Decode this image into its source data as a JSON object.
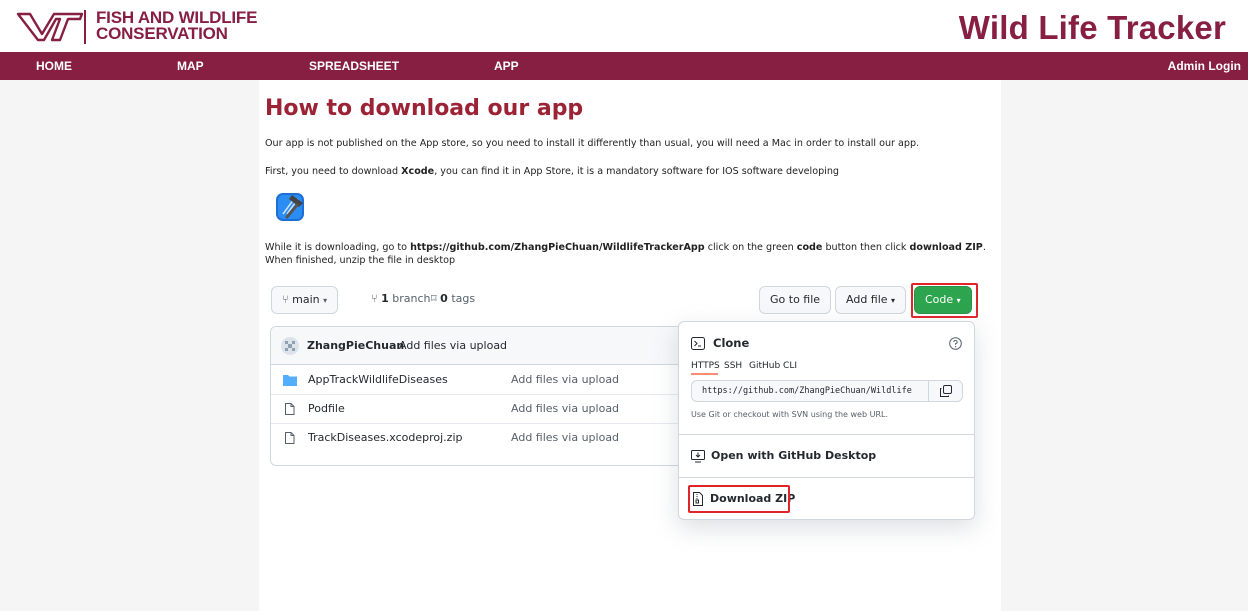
{
  "header": {
    "org_line1": "FISH AND WILDLIFE",
    "org_line2": "CONSERVATION",
    "site_title": "Wild Life Tracker",
    "logo_icon": "vt-logo-icon"
  },
  "nav": {
    "home": "HOME",
    "map": "MAP",
    "spreadsheet": "SPREADSHEET",
    "app": "APP",
    "admin": "Admin Login"
  },
  "main": {
    "title": "How to download our app",
    "intro": "Our app is not published on the App store, so you need to install it differently than usual, you will need a Mac in order to install our app.",
    "xcode_pre": "First, you need to download ",
    "xcode_bold": "Xcode",
    "xcode_post": ", you can find it in App Store, it is a mandatory software for IOS software developing",
    "dl_pre": "While it is downloading, go to ",
    "dl_url": "https://github.com/ZhangPieChuan/WildlifeTrackerApp",
    "dl_mid1": " click on the green ",
    "dl_code": "code",
    "dl_mid2": " button then click ",
    "dl_zip": "download ZIP",
    "dl_post": ". When finished, unzip the file in desktop"
  },
  "github": {
    "branch_label": "main",
    "branch_count": "1",
    "branch_word": "branch",
    "tag_count": "0",
    "tag_word": "tags",
    "goto_file": "Go to file",
    "add_file": "Add file",
    "code_button": "Code",
    "commit_author": "ZhangPieChuan",
    "commit_message": "Add files via upload",
    "files": [
      {
        "name": "AppTrackWildlifeDiseases",
        "message": "Add files via upload",
        "icon": "folder-icon"
      },
      {
        "name": "Podfile",
        "message": "Add files via upload",
        "icon": "file-icon"
      },
      {
        "name": "TrackDiseases.xcodeproj.zip",
        "message": "Add files via upload",
        "icon": "file-icon"
      }
    ],
    "clone": {
      "title": "Clone",
      "tab_https": "HTTPS",
      "tab_ssh": "SSH",
      "tab_cli": "GitHub CLI",
      "url": "https://github.com/ZhangPieChuan/Wildlife",
      "hint": "Use Git or checkout with SVN using the web URL.",
      "open_desktop": "Open with GitHub Desktop",
      "download_zip": "Download ZIP"
    }
  },
  "colors": {
    "brand_maroon": "#861f41",
    "title_red": "#9b2335",
    "github_green": "#2da44e",
    "highlight_red": "#e0242a"
  }
}
